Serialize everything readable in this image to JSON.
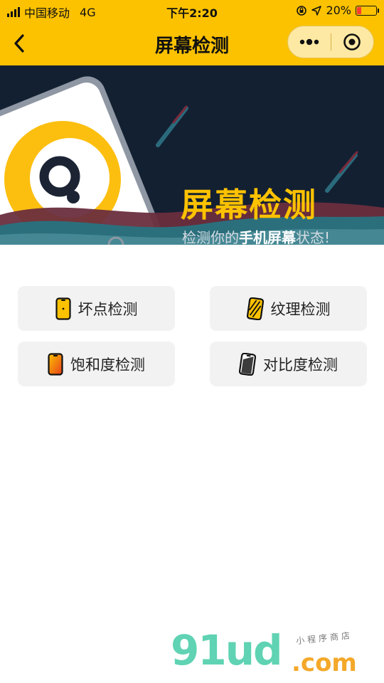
{
  "status_bar": {
    "carrier": "中国移动",
    "network": "4G",
    "time": "下午2:20",
    "battery": "20%",
    "battery_level": 0.2
  },
  "nav": {
    "title": "屏幕检测",
    "more_icon": "more-dots-icon",
    "close_icon": "target-circle-icon"
  },
  "banner": {
    "title": "屏幕检测",
    "subtitle_pre": "检测你的",
    "subtitle_bold": "手机屏幕",
    "subtitle_post": "状态!"
  },
  "tests": [
    {
      "label": "坏点检测",
      "icon": "phone-dot-icon"
    },
    {
      "label": "纹理检测",
      "icon": "phone-stripes-icon"
    },
    {
      "label": "饱和度检测",
      "icon": "phone-gradient-icon"
    },
    {
      "label": "对比度检测",
      "icon": "phone-contrast-icon"
    }
  ],
  "watermark": {
    "brand": "91ud",
    "domain": ".com",
    "tagline": "小程序商店"
  },
  "colors": {
    "accent": "#fcc200",
    "banner_bg": "#132032",
    "button_bg": "#f2f2f2"
  }
}
